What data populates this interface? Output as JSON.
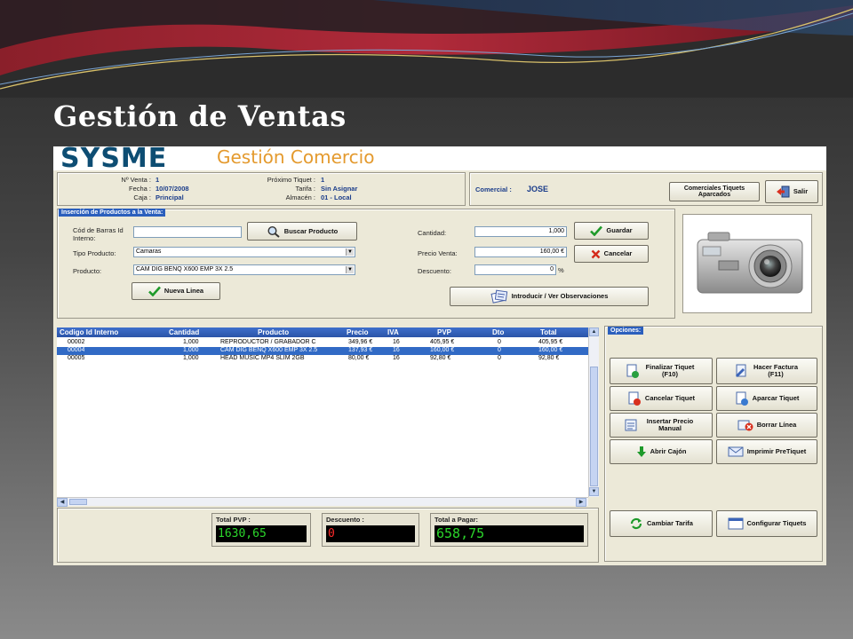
{
  "slide": {
    "title": "Gestión de Ventas"
  },
  "brand": {
    "logo": "SYSME",
    "subtitle": "Gestión Comercio"
  },
  "header": {
    "num_venta_label": "Nº Venta :",
    "num_venta": "1",
    "fecha_label": "Fecha :",
    "fecha": "10/07/2008",
    "caja_label": "Caja :",
    "caja": "Principal",
    "proximo_label": "Próximo Tiquet :",
    "proximo": "1",
    "tarifa_label": "Tarifa :",
    "tarifa": "Sin Asignar",
    "almacen_label": "Almacén :",
    "almacen": "01 - Local",
    "comercial_label": "Comercial :",
    "comercial": "JOSE",
    "btn_comerciales": "Comerciales Tiquets Aparcados",
    "btn_salir": "Salir"
  },
  "insert": {
    "section_title": "Inserción de Productos a la Venta:",
    "codigo_label": "Cód de Barras Id Interno:",
    "codigo_value": "",
    "buscar_label": "Buscar Producto",
    "tipo_label": "Tipo Producto:",
    "tipo_value": "Camaras",
    "producto_label": "Producto:",
    "producto_value": "CAM DIG BENQ X600 EMP 3X 2.5",
    "nueva_label": "Nueva Linea",
    "cantidad_label": "Cantidad:",
    "cantidad_value": "1,000",
    "precio_label": "Precio Venta:",
    "precio_value": "160,00 €",
    "descuento_label": "Descuento:",
    "descuento_value": "0",
    "descuento_unit": "%",
    "guardar_label": "Guardar",
    "cancelar_label": "Cancelar",
    "observaciones_label": "Introducir / Ver  Observaciones"
  },
  "grid": {
    "columns": [
      "Codigo Id Interno",
      "Cantidad",
      "Producto",
      "Precio",
      "IVA",
      "PVP",
      "Dto",
      "Total"
    ],
    "rows": [
      {
        "codigo": "00002",
        "cantidad": "1,000",
        "producto": "REPRODUCTOR / GRABADOR C",
        "precio": "349,96 €",
        "iva": "16",
        "pvp": "405,95 €",
        "dto": "0",
        "total": "405,95 €",
        "selected": false
      },
      {
        "codigo": "00004",
        "cantidad": "1,000",
        "producto": "CAM DIG BENQ X600 EMP 3X 2.5",
        "precio": "137,93 €",
        "iva": "16",
        "pvp": "160,00 €",
        "dto": "0",
        "total": "160,00 €",
        "selected": true
      },
      {
        "codigo": "00005",
        "cantidad": "1,000",
        "producto": "HEAD MUSIC MP4 SLIM 2GB",
        "precio": "80,00 €",
        "iva": "16",
        "pvp": "92,80 €",
        "dto": "0",
        "total": "92,80 €",
        "selected": false
      }
    ]
  },
  "totals": {
    "pvp_label": "Total PVP :",
    "pvp_value": "1630,65",
    "descuento_label": "Descuento :",
    "descuento_value": "0",
    "pagar_label": "Total a Pagar:",
    "pagar_value": "658,75",
    "colors": {
      "pvp": "#2bd62b",
      "descuento": "#ff2a2a",
      "pagar": "#2bd62b"
    }
  },
  "options": {
    "section_title": "Opciones:",
    "finalizar": "Finalizar Tiquet (F10)",
    "factura": "Hacer Factura (F11)",
    "cancelar_tiquet": "Cancelar Tiquet",
    "aparcar": "Aparcar Tiquet",
    "insertar_precio": "Insertar Precio Manual",
    "borrar_linea": "Borrar Línea",
    "abrir_cajon": "Abrir Cajón",
    "imprimir_pre": "Imprimir PreTiquet",
    "cambiar_tarifa": "Cambiar Tarifa",
    "configurar": "Configurar Tiquets"
  }
}
